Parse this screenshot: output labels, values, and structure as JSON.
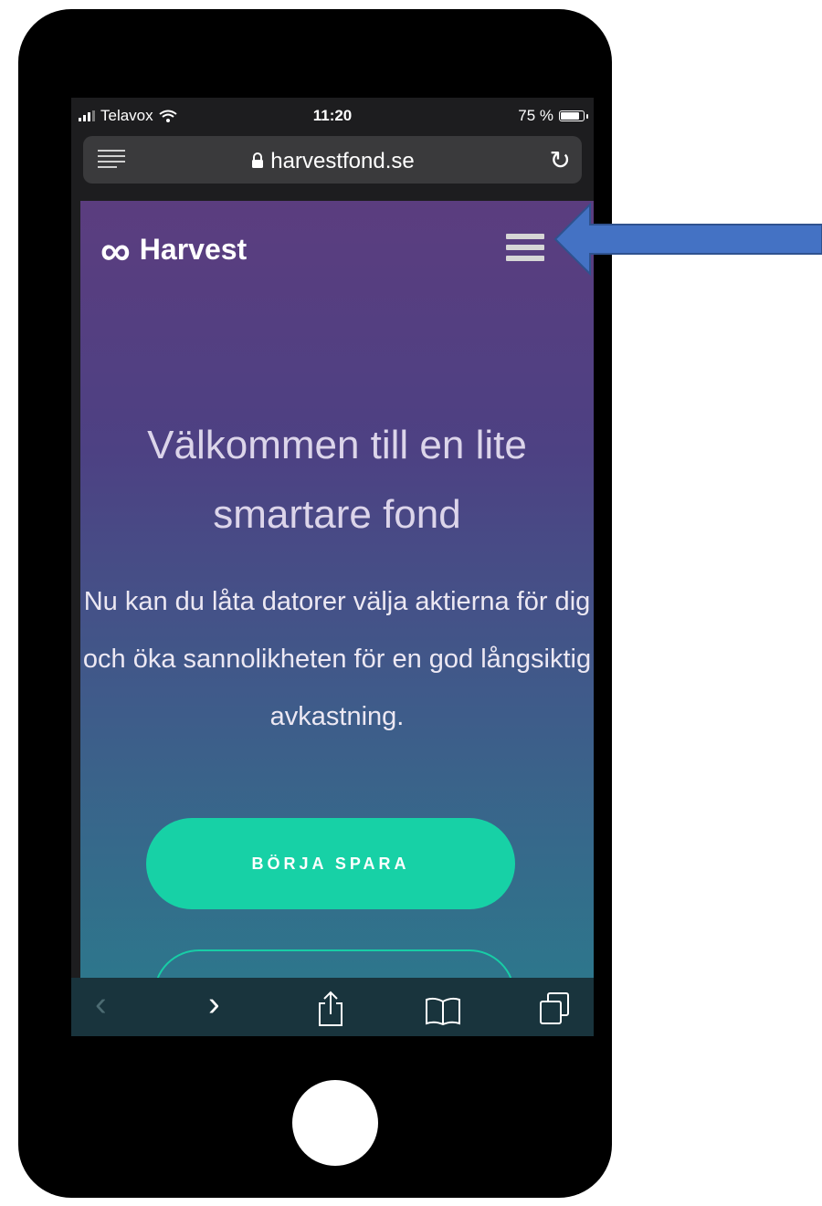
{
  "status_bar": {
    "carrier": "Telavox",
    "time": "11:20",
    "battery": "75 %",
    "battery_level": 0.75
  },
  "browser": {
    "url": "harvestfond.se"
  },
  "site": {
    "brand": "Harvest",
    "hero_title": "Välkommen till en lite smartare fond",
    "hero_text": "Nu kan du låta datorer välja aktierna för dig och öka sannolikheten för en god långsiktig avkastning.",
    "cta_label": "BÖRJA SPARA"
  },
  "icons": [
    "signal-icon",
    "wifi-icon",
    "battery-icon",
    "reader-icon",
    "lock-icon",
    "reload-icon",
    "infinity-logo-icon",
    "hamburger-menu-icon",
    "back-icon",
    "forward-icon",
    "share-icon",
    "bookmarks-icon",
    "tabs-icon",
    "annotation-arrow-icon"
  ],
  "colors": {
    "cta": "#17d1a6",
    "arrow": "#4472c4",
    "hero_top": "#5b3d7f",
    "hero_bottom": "#2a7c8c"
  }
}
